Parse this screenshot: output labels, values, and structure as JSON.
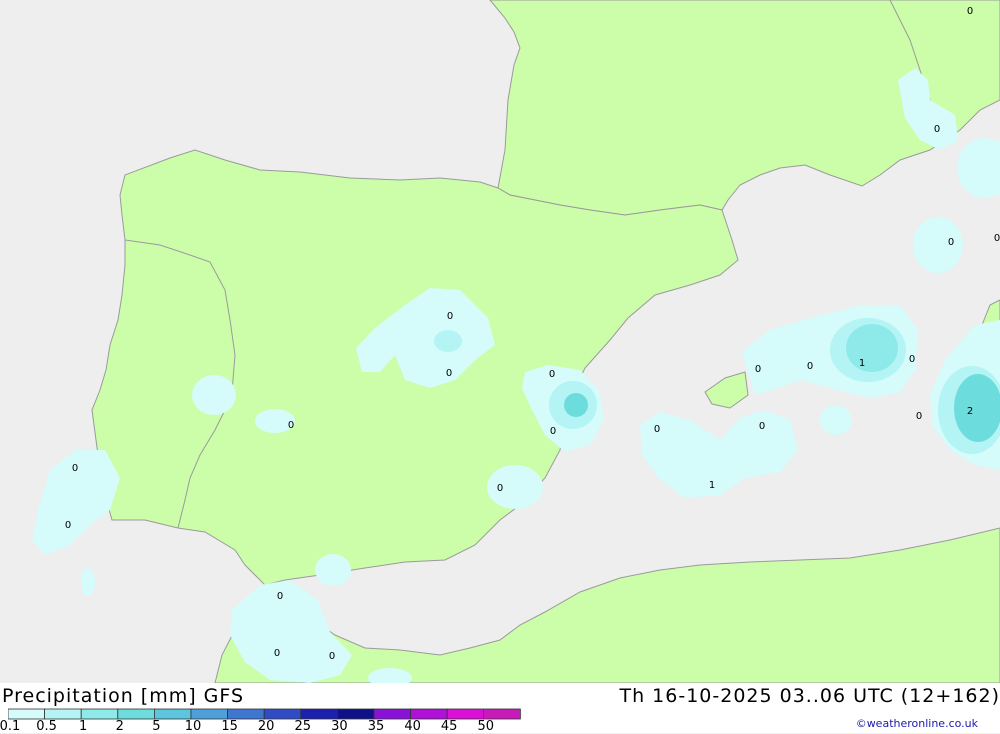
{
  "title": "Precipitation [mm] GFS",
  "datetime": "Th 16-10-2025 03..06 UTC (12+162)",
  "credit": "©weatheronline.co.uk",
  "scale": {
    "labels": [
      "0.1",
      "0.5",
      "1",
      "2",
      "5",
      "10",
      "15",
      "20",
      "25",
      "30",
      "35",
      "40",
      "45",
      "50"
    ],
    "colors": [
      "#d5fbfb",
      "#b4f4f4",
      "#8ee9e9",
      "#6ddcdc",
      "#5bc6de",
      "#4f9fd9",
      "#3f76d0",
      "#2f4cc4",
      "#1c20ad",
      "#101088",
      "#8a12d8",
      "#b010d8",
      "#da10d8",
      "#c81ab8"
    ]
  },
  "colors": {
    "sea": "#eeeeee",
    "land": "#ccfeaa",
    "coast": "#9a9a9a",
    "precip_light": "#d5fbfb",
    "precip_medium": "#b4f4f4",
    "precip_strong": "#6ddcdc"
  },
  "map_labels": [
    "0",
    "0",
    "0",
    "1",
    "0",
    "0",
    "0",
    "0",
    "0",
    "0",
    "0",
    "0",
    "0",
    "0",
    "0",
    "0",
    "1",
    "0",
    "0",
    "2",
    "0",
    "0",
    "0",
    "0"
  ]
}
